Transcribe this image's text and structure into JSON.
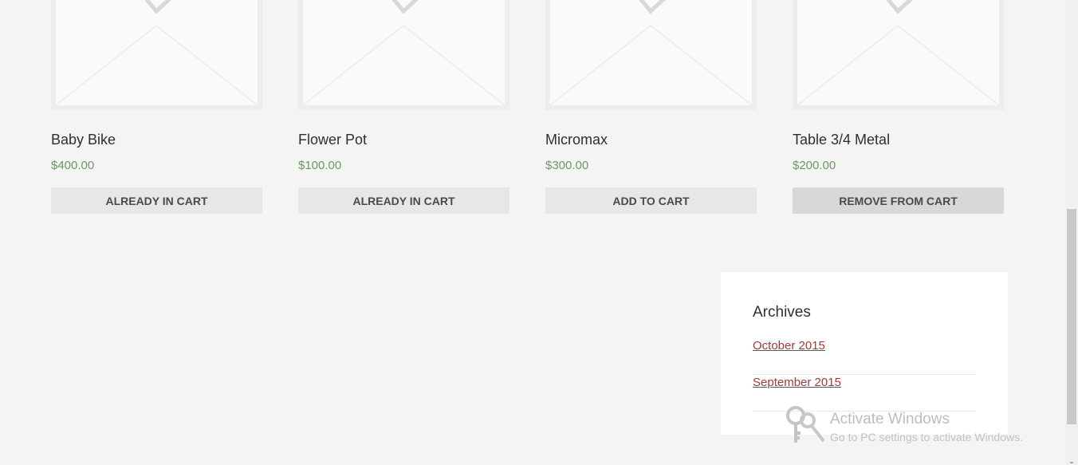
{
  "products": [
    {
      "name": "Baby Bike",
      "price": "$400.00",
      "button": "ALREADY IN CART"
    },
    {
      "name": "Flower Pot",
      "price": "$100.00",
      "button": "ALREADY IN CART"
    },
    {
      "name": "Micromax",
      "price": "$300.00",
      "button": "ADD TO CART"
    },
    {
      "name": "Table 3/4 Metal",
      "price": "$200.00",
      "button": "REMOVE FROM CART"
    }
  ],
  "archives": {
    "title": "Archives",
    "items": [
      {
        "label": "October 2015"
      },
      {
        "label": "September 2015"
      }
    ]
  },
  "watermark": {
    "title": "Activate Windows",
    "subtitle": "Go to PC settings to activate Windows."
  },
  "colors": {
    "price": "#6a9a5f",
    "link": "#a33a3a",
    "button_bg": "#e8e7e8"
  }
}
